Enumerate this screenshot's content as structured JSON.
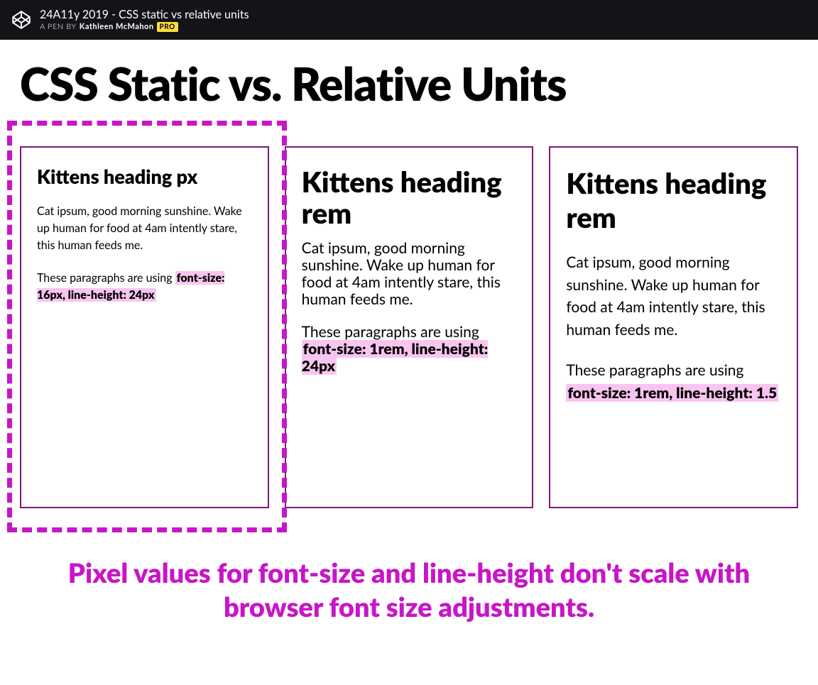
{
  "header": {
    "title": "24A11y 2019 - CSS static vs relative units",
    "byline_prefix": "A PEN BY",
    "author": "Kathleen McMahon",
    "badge": "PRO"
  },
  "main_title": "CSS Static vs. Relative Units",
  "cards": [
    {
      "heading": "Kittens heading px",
      "p1": "Cat ipsum, good morning sunshine. Wake up human for food at 4am intently stare, this human feeds me.",
      "p2_lead": "These paragraphs are using ",
      "p2_hl": "font-size: 16px, line-height: 24px"
    },
    {
      "heading": "Kittens heading rem",
      "p1": "Cat ipsum, good morning sunshine. Wake up human for food at 4am intently stare, this human feeds me.",
      "p2_lead": "These paragraphs are using ",
      "p2_hl": "font-size: 1rem, line-height: 24px"
    },
    {
      "heading": "Kittens heading rem",
      "p1": "Cat ipsum, good morning sunshine. Wake up human for food at 4am intently stare, this human feeds me.",
      "p2_lead": "These paragraphs are using ",
      "p2_hl": "font-size: 1rem, line-height: 1.5"
    }
  ],
  "caption": "Pixel values for font-size and line-height don't scale with browser font size adjustments."
}
